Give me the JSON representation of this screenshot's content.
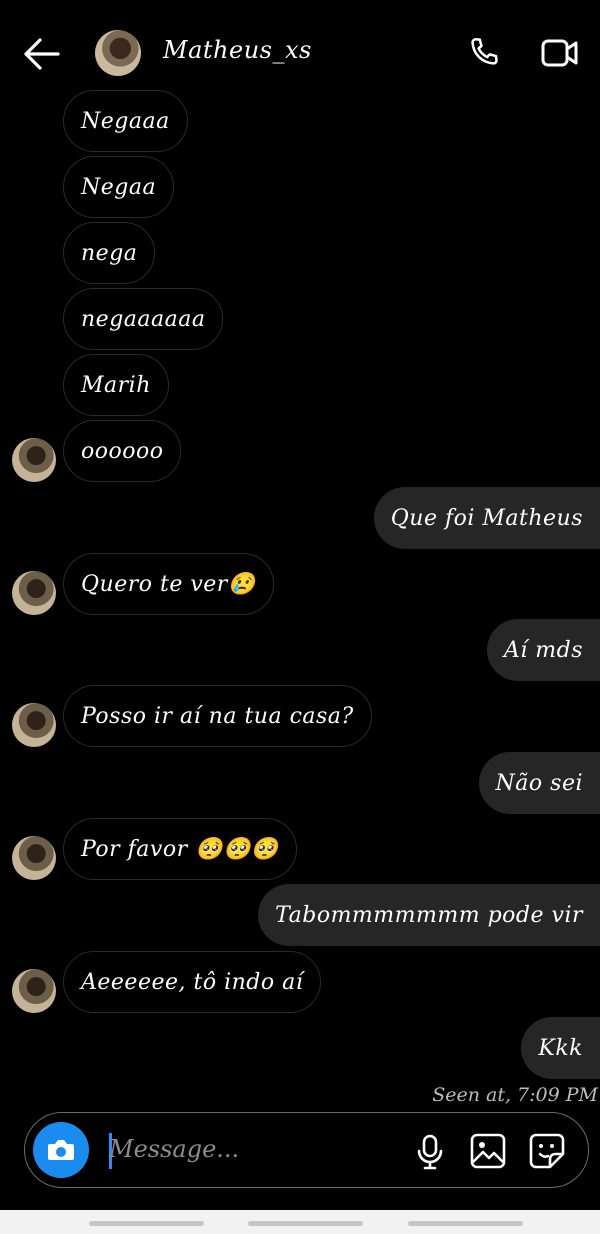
{
  "header": {
    "contact_name": "Matheus_xs"
  },
  "messages": [
    {
      "text": "Negaaa"
    },
    {
      "text": "Negaa"
    },
    {
      "text": "nega"
    },
    {
      "text": "negaaaaaa"
    },
    {
      "text": "Marih"
    },
    {
      "text": "oooooo"
    },
    {
      "text": "Que foi Matheus"
    },
    {
      "text": "Quero te ver😢"
    },
    {
      "text": "Aí mds"
    },
    {
      "text": "Posso ir aí na tua casa?"
    },
    {
      "text": "Não sei"
    },
    {
      "text": "Por favor 🥺🥺🥺"
    },
    {
      "text": "Tabommmmmmm pode vir"
    },
    {
      "text": "Aeeeeee, tô indo aí"
    },
    {
      "text": "Kkk"
    }
  ],
  "seen": "Seen at, 7:09 PM",
  "composer": {
    "placeholder": "Message..."
  },
  "colors": {
    "accent": "#1a8cf0",
    "outgoing_bubble": "#262626",
    "background": "#000000"
  },
  "icons": [
    "back-arrow-icon",
    "phone-icon",
    "video-camera-icon",
    "camera-icon",
    "microphone-icon",
    "gallery-icon",
    "sticker-icon"
  ]
}
